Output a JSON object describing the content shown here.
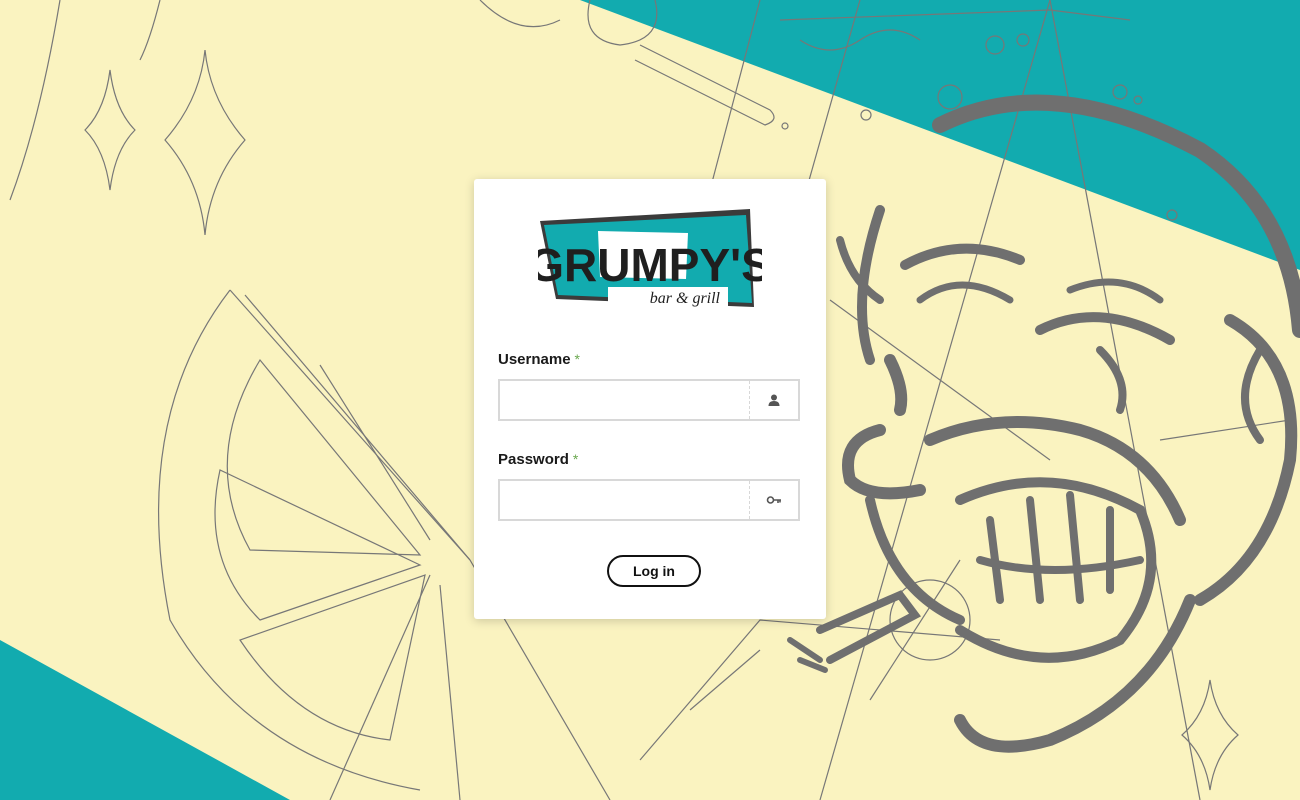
{
  "logo": {
    "wordmark": "GRUMPY'S",
    "tagline": "bar & grill"
  },
  "form": {
    "username_label": "Username",
    "password_label": "Password",
    "required_mark": "*",
    "username_value": "",
    "password_value": "",
    "username_icon": "user-icon",
    "password_icon": "key-icon",
    "login_label": "Log in"
  },
  "colors": {
    "background": "#faf3c0",
    "teal": "#12abaf",
    "caricature": "#6f6f6f",
    "required": "#6aa84f"
  }
}
